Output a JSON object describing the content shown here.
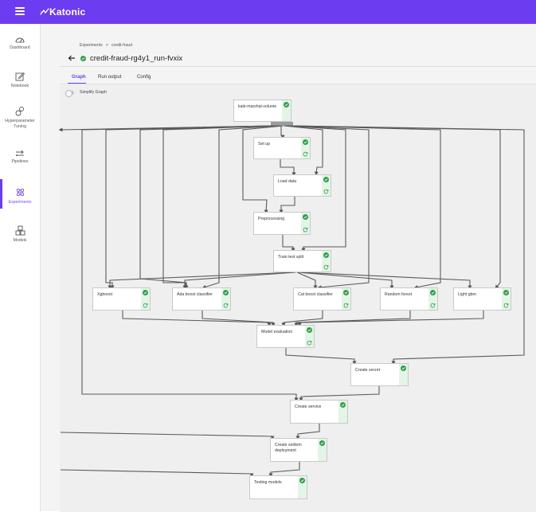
{
  "app": {
    "brand": "Katonic",
    "accent": "#6c3cf0",
    "menu_icon": "hamburger-menu-icon",
    "logo_icon": "katonic-logo-icon"
  },
  "sidebar": {
    "items": [
      {
        "label": "Dashboard",
        "icon": "gauge-icon"
      },
      {
        "label": "Notebook",
        "icon": "notebook-edit-icon"
      },
      {
        "label": "Hyperparameter Tuning",
        "icon": "hyperparameter-flask-icon"
      },
      {
        "label": "Pipelines",
        "icon": "pipeline-arrows-icon"
      },
      {
        "label": "Experiments",
        "icon": "experiments-atom-icon",
        "active": true
      },
      {
        "label": "Models",
        "icon": "models-cubes-icon"
      }
    ]
  },
  "breadcrumb": {
    "root": "Experiments",
    "separator": ">",
    "current": "credit-fraud"
  },
  "run": {
    "title": "credit-fraud-rg4y1_run-fvxix",
    "status": "succeeded",
    "status_color": "#2e9e4a"
  },
  "tabs": [
    {
      "label": "Graph",
      "active": true
    },
    {
      "label": "Run output",
      "active": false
    },
    {
      "label": "Config",
      "active": false
    }
  ],
  "graph": {
    "simplify_label": "Simplify Graph",
    "simplify_on": false,
    "node_status_color": "#2e9e4a",
    "nodes": [
      {
        "id": "volume",
        "label": "kale-marshal-volume",
        "done": true,
        "cached": false
      },
      {
        "id": "setup",
        "label": "Set up",
        "done": true,
        "cached": true
      },
      {
        "id": "load",
        "label": "Load data",
        "done": true,
        "cached": true
      },
      {
        "id": "prep",
        "label": "Preprocessing",
        "done": true,
        "cached": true
      },
      {
        "id": "split",
        "label": "Train test split",
        "done": true,
        "cached": true
      },
      {
        "id": "xgb",
        "label": "Xgboost",
        "done": true,
        "cached": true
      },
      {
        "id": "ada",
        "label": "Ada boost classifier",
        "done": true,
        "cached": true
      },
      {
        "id": "cat",
        "label": "Cat boost classifier",
        "done": true,
        "cached": true
      },
      {
        "id": "rf",
        "label": "Random forest",
        "done": true,
        "cached": true
      },
      {
        "id": "lgbm",
        "label": "Light gbm",
        "done": true,
        "cached": true
      },
      {
        "id": "eval",
        "label": "Model evaluation",
        "done": true,
        "cached": true
      },
      {
        "id": "secret",
        "label": "Create secret",
        "done": true,
        "cached": false
      },
      {
        "id": "service",
        "label": "Create service",
        "done": true,
        "cached": false
      },
      {
        "id": "seldon",
        "label": "Create seldom deployment",
        "done": true,
        "cached": false
      },
      {
        "id": "test",
        "label": "Testing models",
        "done": true,
        "cached": false
      }
    ]
  }
}
